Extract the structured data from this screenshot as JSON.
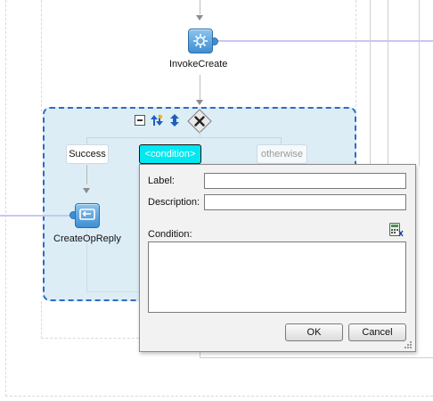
{
  "diagram": {
    "invoke_activity": {
      "label": "InvokeCreate",
      "icon": "gear-icon"
    },
    "reply_activity": {
      "label": "CreateOpReply",
      "icon": "reply-icon"
    },
    "switch": {
      "toolbar": [
        "collapse-icon",
        "expand-cases-icon",
        "reorder-cases-icon",
        "delete-switch-icon"
      ],
      "cases": {
        "success": "Success",
        "condition": "<condition>",
        "otherwise": "otherwise"
      },
      "colors": {
        "fill": "#dcedf6",
        "border": "#2e6bc5",
        "selected_case": "#00e8f0"
      }
    }
  },
  "dialog": {
    "label_field": {
      "label": "Label:",
      "value": ""
    },
    "description_field": {
      "label": "Description:",
      "value": ""
    },
    "condition_field": {
      "label": "Condition:",
      "value": ""
    },
    "expression_builder_icon": "expression-builder-icon",
    "ok_label": "OK",
    "cancel_label": "Cancel"
  }
}
